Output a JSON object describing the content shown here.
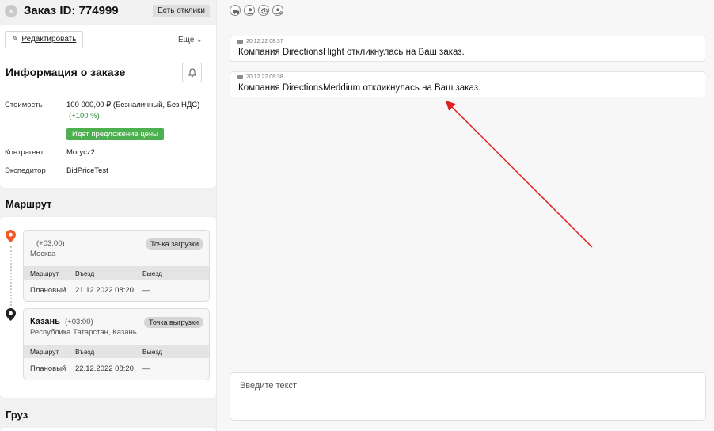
{
  "header": {
    "title": "Заказ ID: 774999",
    "responses_button": "Есть отклики"
  },
  "toolbar": {
    "edit_label": "Редактировать",
    "more_label": "Еще"
  },
  "info": {
    "title": "Информация о заказе",
    "cost_label": "Стоимость",
    "cost_value": "100 000,00 ₽ (Безналичный, Без НДС)",
    "cost_percent": "(+100 %)",
    "price_badge": "Идет предложение цены",
    "contractor_label": "Контрагент",
    "contractor_value": "Morycz2",
    "forwarder_label": "Экспедитор",
    "forwarder_value": "BidPriceTest"
  },
  "route": {
    "title": "Маршрут",
    "stops": [
      {
        "city": "",
        "timezone": "(+03:00)",
        "region": "Москва",
        "tag": "Точка загрузки",
        "columns": [
          "Маршрут",
          "Въезд",
          "Выезд"
        ],
        "row": [
          "Плановый",
          "21.12.2022 08:20",
          "—"
        ]
      },
      {
        "city": "Казань",
        "timezone": "(+03:00)",
        "region": "Республика Татарстан, Казань",
        "tag": "Точка выгрузки",
        "columns": [
          "Маршрут",
          "Въезд",
          "Выезд"
        ],
        "row": [
          "Плановый",
          "22.12.2022 08:20",
          "—"
        ]
      }
    ]
  },
  "cargo": {
    "title": "Груз"
  },
  "chat": {
    "role_icons": [
      "truck-icon",
      "user-icon",
      "gear-icon",
      "user-settings-icon"
    ],
    "messages": [
      {
        "time": "20.12.22 08:37",
        "text": "Компания DirectionsHight откликнулась на Ваш заказ."
      },
      {
        "time": "20.12.22 08:38",
        "text": "Компания DirectionsMeddium откликнулась на Ваш заказ."
      }
    ],
    "input_placeholder": "Введите текст"
  },
  "colors": {
    "accent_green": "#4caf50",
    "pin_start": "#f05a28",
    "annotation_arrow": "#e02020"
  }
}
